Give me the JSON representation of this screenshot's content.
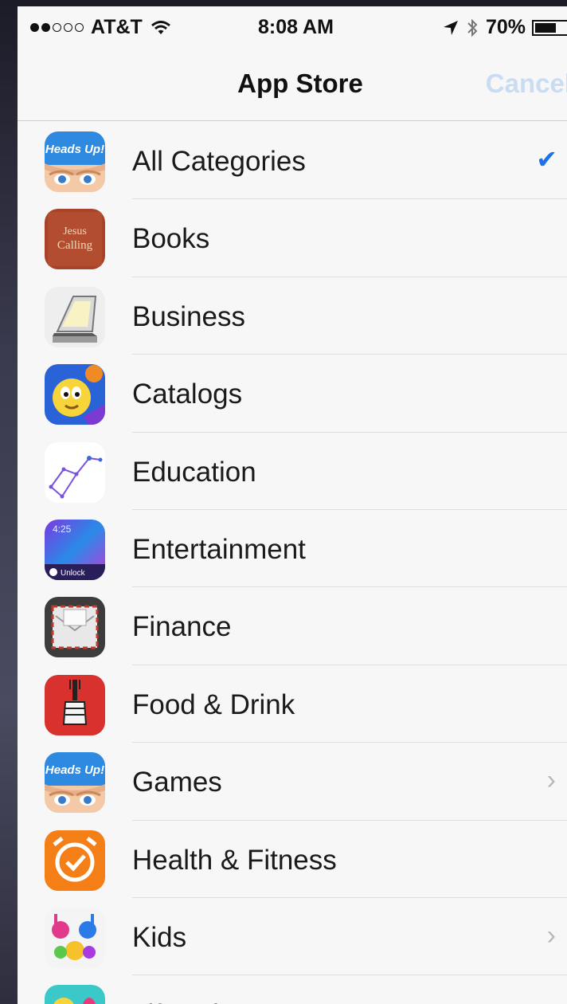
{
  "status_bar": {
    "signal_strength": 2,
    "signal_total": 5,
    "carrier": "AT&T",
    "time": "8:08 AM",
    "battery": "70%",
    "battery_level": 0.7
  },
  "nav": {
    "title": "App Store",
    "cancel_label": "Cancel"
  },
  "categories": [
    {
      "label": "All Categories",
      "icon": "heads-up-icon",
      "selected": true,
      "chevron": false
    },
    {
      "label": "Books",
      "icon": "jesus-calling-icon",
      "icon_text": "Jesus Calling",
      "selected": false,
      "chevron": false
    },
    {
      "label": "Business",
      "icon": "scanner-icon",
      "selected": false,
      "chevron": false
    },
    {
      "label": "Catalogs",
      "icon": "emoji-face-icon",
      "selected": false,
      "chevron": false
    },
    {
      "label": "Education",
      "icon": "constellation-icon",
      "selected": false,
      "chevron": false
    },
    {
      "label": "Entertainment",
      "icon": "lockscreen-icon",
      "icon_text": "4:25",
      "icon_text2": "Unlock",
      "selected": false,
      "chevron": false
    },
    {
      "label": "Finance",
      "icon": "envelope-icon",
      "selected": false,
      "chevron": false
    },
    {
      "label": "Food & Drink",
      "icon": "fork-fist-icon",
      "selected": false,
      "chevron": false
    },
    {
      "label": "Games",
      "icon": "heads-up-icon",
      "selected": false,
      "chevron": true
    },
    {
      "label": "Health & Fitness",
      "icon": "alarm-clock-icon",
      "selected": false,
      "chevron": false
    },
    {
      "label": "Kids",
      "icon": "painted-hands-icon",
      "selected": false,
      "chevron": true
    },
    {
      "label": "Lifestyle",
      "icon": "emoji-hearts-icon",
      "selected": false,
      "chevron": false
    }
  ],
  "colors": {
    "accent": "#1a73e8",
    "cancel_disabled": "#c9dcf3",
    "list_bg": "#f7f7f7"
  }
}
